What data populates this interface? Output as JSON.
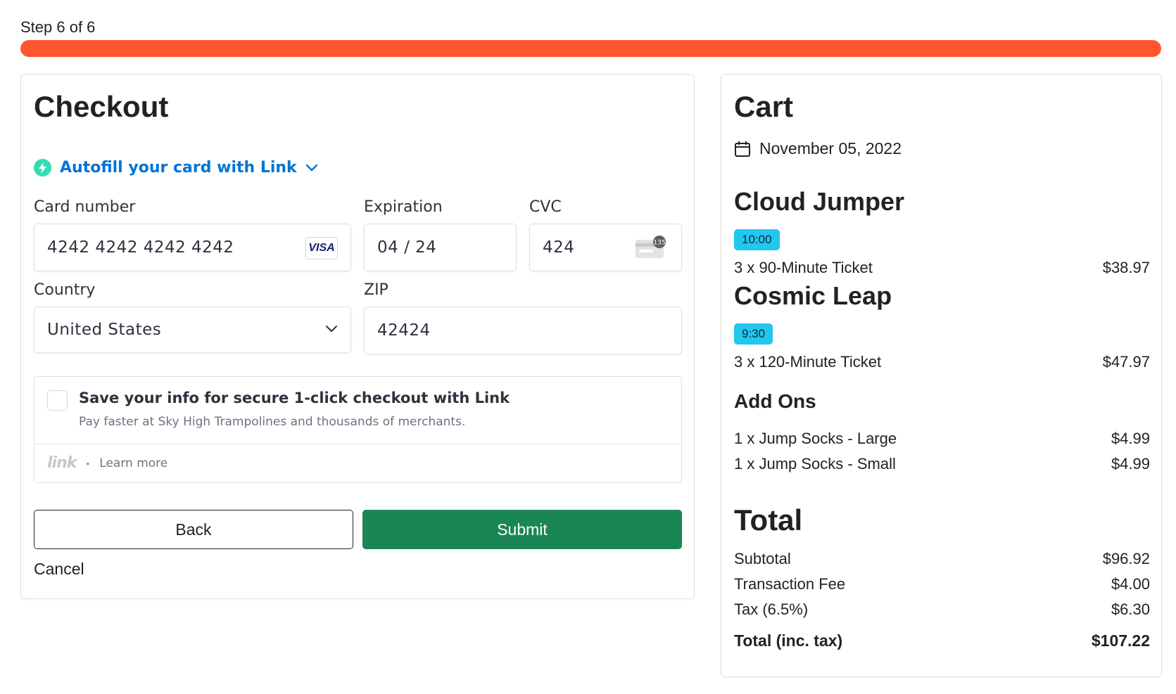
{
  "progress": {
    "label": "Step 6 of 6",
    "fraction": 1.0,
    "color": "#ff5630"
  },
  "checkout": {
    "title": "Checkout",
    "autofill_label": "Autofill your card with Link",
    "card_number_label": "Card number",
    "card_number_value": "4242 4242 4242 4242",
    "card_brand": "VISA",
    "expiration_label": "Expiration",
    "expiration_value": "04 / 24",
    "cvc_label": "CVC",
    "cvc_value": "424",
    "country_label": "Country",
    "country_value": "United States",
    "zip_label": "ZIP",
    "zip_value": "42424",
    "save_info_title": "Save your info for secure 1-click checkout with Link",
    "save_info_sub": "Pay faster at Sky High Trampolines and thousands of merchants.",
    "link_logo": "link",
    "learn_more": "Learn more",
    "back_label": "Back",
    "submit_label": "Submit",
    "cancel_label": "Cancel",
    "submit_color": "#1a8654",
    "link_color": "#0074d4"
  },
  "cart": {
    "title": "Cart",
    "date": "November 05, 2022",
    "items": [
      {
        "title": "Cloud Jumper",
        "time": "10:00",
        "line": "3 x 90-Minute Ticket",
        "price": "$38.97"
      },
      {
        "title": "Cosmic Leap",
        "time": "9:30",
        "line": "3 x 120-Minute Ticket",
        "price": "$47.97"
      }
    ],
    "addons_title": "Add Ons",
    "addons": [
      {
        "line": "1 x Jump Socks - Large",
        "price": "$4.99"
      },
      {
        "line": "1 x Jump Socks - Small",
        "price": "$4.99"
      }
    ],
    "total_title": "Total",
    "subtotal_label": "Subtotal",
    "subtotal_value": "$96.92",
    "fee_label": "Transaction Fee",
    "fee_value": "$4.00",
    "tax_label": "Tax (6.5%)",
    "tax_value": "$6.30",
    "grand_label": "Total (inc. tax)",
    "grand_value": "$107.22",
    "badge_color": "#22c7f0"
  }
}
